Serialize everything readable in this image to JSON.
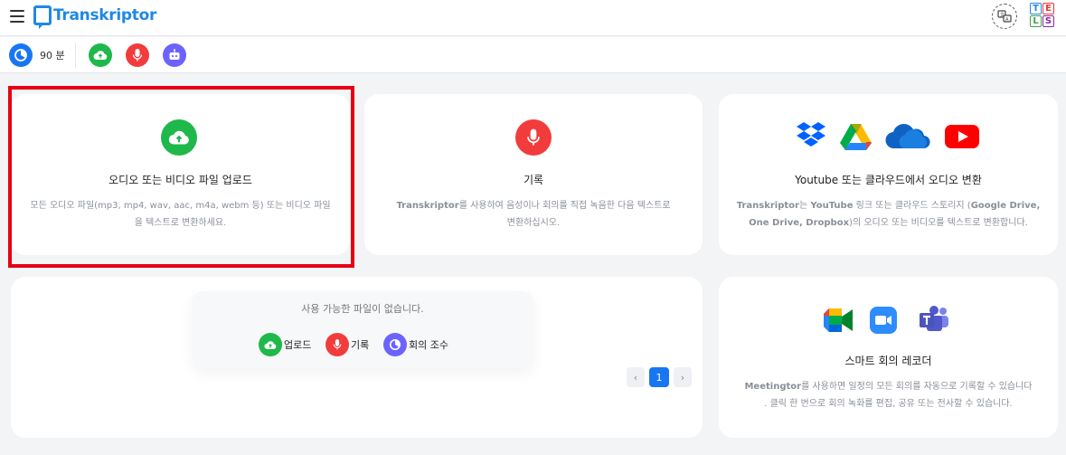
{
  "header": {
    "app_name": "Transkriptor",
    "tels_letters": [
      "T",
      "E",
      "L",
      "S"
    ],
    "tels_colors": [
      "#1e88e5",
      "#e53935",
      "#43a047",
      "#8e24aa"
    ]
  },
  "toolbar": {
    "minutes_label": "90 분",
    "colors": {
      "minutes": "#1976f2",
      "upload": "#1fb84a",
      "record": "#f23c3c",
      "bot": "#6c63ff"
    }
  },
  "cards": {
    "upload": {
      "title": "오디오 또는 비디오 파일 업로드",
      "desc_line1": "모든 오디오 파일(mp3, mp4, wav, aac, m4a, webm 등) 또는 비디오 파일",
      "desc_line2": "을 텍스트로 변환하세요.",
      "icon_color": "#1fb84a"
    },
    "record": {
      "title": "기록",
      "desc_bold": "Transkriptor",
      "desc_line1_rest": "를 사용하여 음성이나 회의를 직접 녹음한 다음 텍스트로",
      "desc_line2": "변환하십시오.",
      "icon_color": "#f23c3c"
    },
    "cloud": {
      "title": "Youtube 또는 클라우드에서 오디오 변환",
      "desc_line1_bold": "Transkriptor",
      "desc_line1_mid": "는 ",
      "desc_line1_bold2": "YouTube",
      "desc_line1_rest": " 링크 또는 클라우드 스토리지 (",
      "desc_line1_bold3": "Google Drive,",
      "desc_line2_bold": "One Drive, Dropbox",
      "desc_line2_rest": ")의 오디오 또는 비디오를 텍스트로 변환합니다."
    },
    "files": {
      "empty_text": "사용 가능한 파일이 없습니다.",
      "actions": [
        {
          "label": "업로드",
          "color": "#1fb84a"
        },
        {
          "label": "기록",
          "color": "#f23c3c"
        },
        {
          "label": "회의 조수",
          "color": "#6c63ff"
        }
      ],
      "pager": {
        "prev": "‹",
        "current": "1",
        "next": "›"
      }
    },
    "meeting": {
      "title": "스마트 회의 레코더",
      "desc_bold": "Meetingtor",
      "desc_line1_rest": "를 사용하면 일정의 모든 회의를 자동으로 기록할 수 있습니다",
      "desc_line2": ". 클릭 한 번으로 회의 녹화를 편집, 공유 또는 전사할 수 있습니다."
    }
  }
}
